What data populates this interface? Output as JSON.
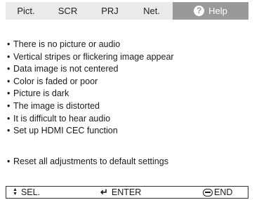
{
  "tabs": [
    {
      "label": "Pict."
    },
    {
      "label": "SCR"
    },
    {
      "label": "PRJ"
    },
    {
      "label": "Net."
    },
    {
      "label": "Help",
      "icon": "question-icon"
    }
  ],
  "active_tab": "Help",
  "menu_items": [
    {
      "label": "There is no picture or audio"
    },
    {
      "label": "Vertical stripes or flickering image appear"
    },
    {
      "label": "Data image is not centered"
    },
    {
      "label": "Color is faded or poor"
    },
    {
      "label": "Picture is dark"
    },
    {
      "label": "The image is distorted"
    },
    {
      "label": "It is difficult to hear audio"
    },
    {
      "label": "Set up HDMI CEC function"
    }
  ],
  "reset_item": {
    "label": "Reset all adjustments to default settings"
  },
  "bullet": "•",
  "help_icon_glyph": "?",
  "statusbar": {
    "select_label": "SEL.",
    "enter_label": "ENTER",
    "end_label": "END",
    "select_icon": "up-down-arrow-icon",
    "enter_icon": "enter-arrow-icon",
    "end_icon": "menu-button-icon"
  },
  "colors": {
    "tab_bar": "#eaeaea",
    "active_tab": "#999999",
    "text": "#1a1a1a"
  }
}
